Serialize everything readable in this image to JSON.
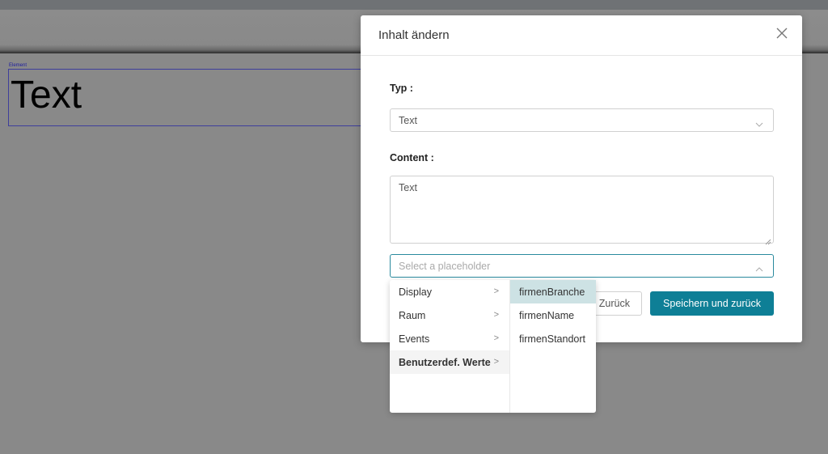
{
  "background": {
    "element_label": "Element",
    "element_text": "Text"
  },
  "modal": {
    "title": "Inhalt ändern",
    "type_label": "Typ :",
    "type_value": "Text",
    "content_label": "Content :",
    "content_value": "Text",
    "placeholder_select": "Select a placeholder",
    "back_button": "Zurück",
    "save_button": "Speichern und zurück"
  },
  "cascader": {
    "level1": [
      {
        "label": "Display"
      },
      {
        "label": "Raum"
      },
      {
        "label": "Events"
      },
      {
        "label": "Benutzerdef. Werte"
      }
    ],
    "level2": [
      {
        "label": "firmenBranche"
      },
      {
        "label": "firmenName"
      },
      {
        "label": "firmenStandort"
      }
    ],
    "arrow": ">"
  },
  "colors": {
    "primary": "#0e7f96",
    "highlight": "#cde2e4",
    "overlay": "#898989"
  }
}
